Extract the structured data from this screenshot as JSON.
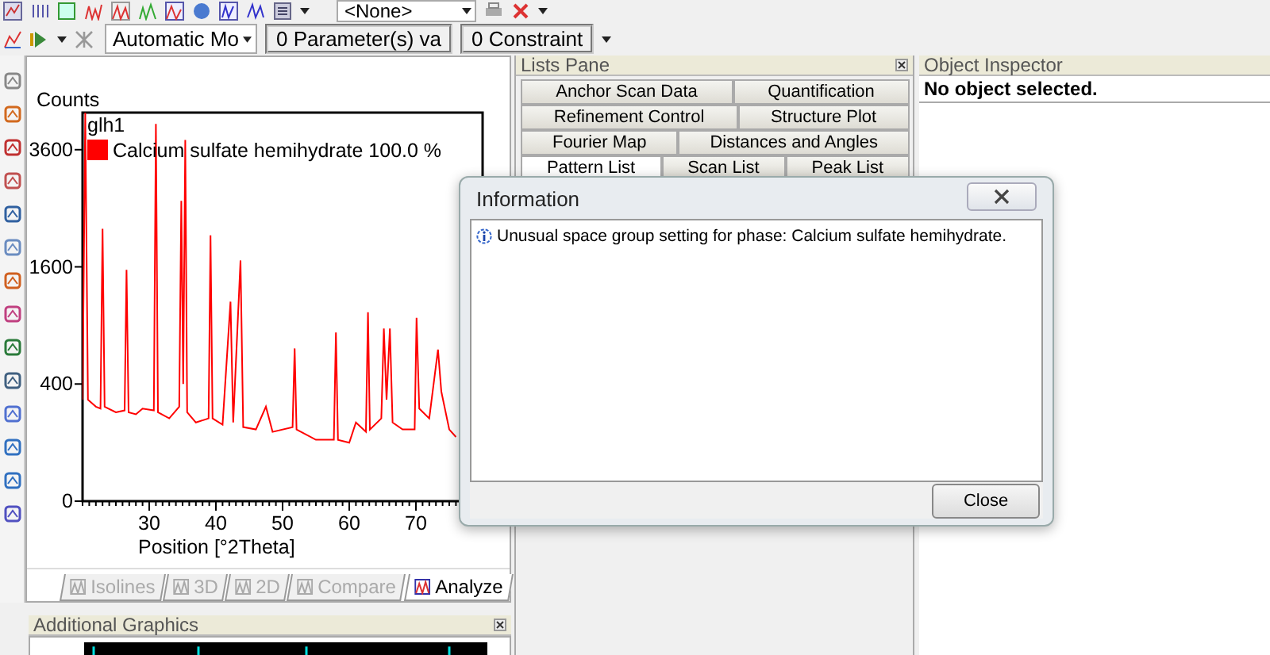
{
  "toolbar": {
    "preset_dropdown": "<None>",
    "mode_dropdown": "Automatic Mo",
    "parameters_field": "0 Parameter(s) va",
    "constraints_field": "0 Constraint"
  },
  "main_view": {
    "plot": {
      "y_axis_title": "Counts",
      "scan_name": "glh1",
      "y_tick_labels": [
        "3600",
        "1600",
        "400",
        "0"
      ],
      "x_tick_labels": [
        "30",
        "40",
        "50",
        "60",
        "70"
      ],
      "x_axis_title": "Position [°2Theta]",
      "legend": [
        {
          "label": "Calcium sulfate hemihydrate 100.0 %",
          "color": "#ff0000"
        }
      ]
    },
    "tabs": [
      {
        "label": "Isolines",
        "selected": false,
        "disabled": true
      },
      {
        "label": "3D",
        "selected": false,
        "disabled": true
      },
      {
        "label": "2D",
        "selected": false,
        "disabled": true
      },
      {
        "label": "Compare",
        "selected": false,
        "disabled": true
      },
      {
        "label": "Analyze",
        "selected": true,
        "disabled": false
      }
    ]
  },
  "additional_graphics": {
    "title": "Additional Graphics"
  },
  "lists_pane": {
    "title": "Lists Pane",
    "tab_rows": [
      [
        {
          "label": "Anchor Scan Data",
          "selected": false
        },
        {
          "label": "Quantification",
          "selected": false
        }
      ],
      [
        {
          "label": "Refinement Control",
          "selected": false
        },
        {
          "label": "Structure Plot",
          "selected": false
        }
      ],
      [
        {
          "label": "Fourier Map",
          "selected": false
        },
        {
          "label": "Distances and Angles",
          "selected": false
        }
      ],
      [
        {
          "label": "Pattern List",
          "selected": true
        },
        {
          "label": "Scan List",
          "selected": false
        },
        {
          "label": "Peak List",
          "selected": false
        }
      ]
    ]
  },
  "object_inspector": {
    "title": "Object Inspector",
    "status": "No object selected."
  },
  "dialog": {
    "title": "Information",
    "message": "Unusual space group setting for phase: Calcium sulfate hemihydrate.",
    "buttons": [
      "Close"
    ]
  }
}
